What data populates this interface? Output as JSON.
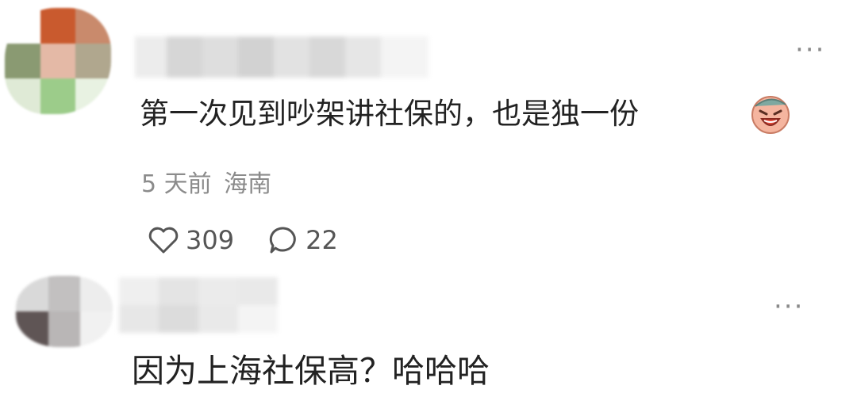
{
  "comments": [
    {
      "text": "第一次见到吵架讲社保的，也是独一份",
      "emoji": "laughing-crying-sticker",
      "time": "5 天前",
      "location": "海南",
      "likes": "309",
      "replies": "22",
      "more_label": "···"
    },
    {
      "text": "因为上海社保高？哈哈哈",
      "more_label": "···"
    }
  ],
  "colors": {
    "text": "#222222",
    "meta": "#8b8b8b",
    "icon": "#555555"
  }
}
